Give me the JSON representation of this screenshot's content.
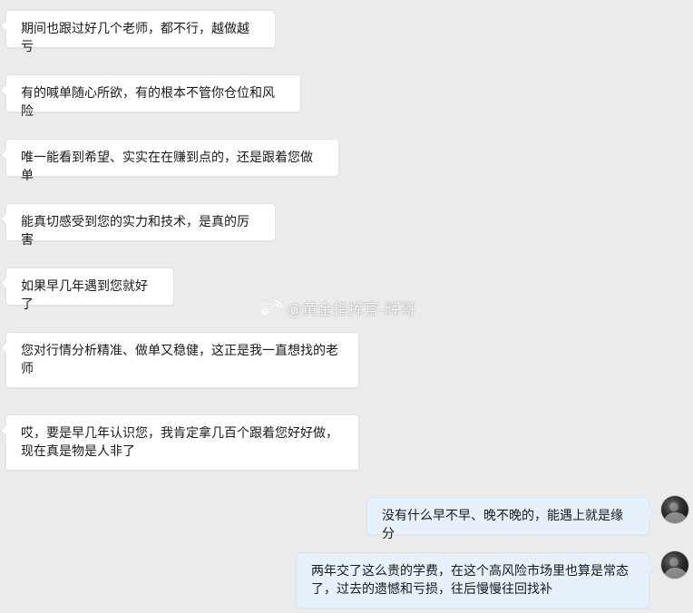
{
  "messages": {
    "left": [
      "期间也跟过好几个老师，都不行，越做越亏",
      "有的喊单随心所欲，有的根本不管你仓位和风险",
      "唯一能看到希望、实实在在赚到点的，还是跟着您做单",
      "能真切感受到您的实力和技术，是真的厉害",
      "如果早几年遇到您就好了",
      "您对行情分析精准、做单又稳健，这正是我一直想找的老师",
      "哎，要是早几年认识您，我肯定拿几百个跟着您好好做，现在真是物是人非了"
    ],
    "right": [
      "没有什么早不早、晚不晚的，能遇上就是缘分",
      "两年交了这么贵的学费，在这个高风险市场里也算是常态了，过去的遗憾和亏损，往后慢慢往回找补"
    ]
  },
  "watermark": {
    "icon": "weibo-icon",
    "text": "@黄金指挥官-辉哥"
  },
  "colors": {
    "background": "#ebebeb",
    "left_bubble": "#ffffff",
    "right_bubble": "#e6f1fb"
  }
}
